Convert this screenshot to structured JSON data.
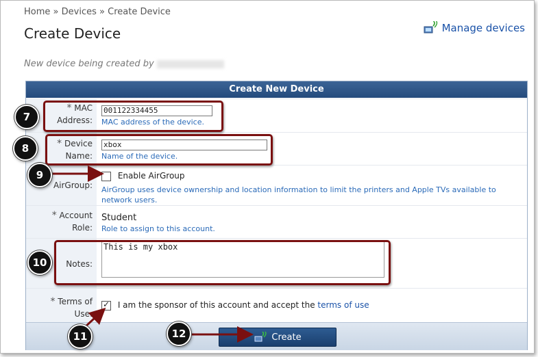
{
  "breadcrumb": {
    "home": "Home",
    "sep": "»",
    "devices": "Devices",
    "current": "Create Device"
  },
  "page_title": "Create Device",
  "manage_link": "Manage devices",
  "subtitle": "New device being created by",
  "form": {
    "header": "Create New Device",
    "required_mark": "*",
    "mac": {
      "label_1": "MAC",
      "label_2": "Address:",
      "value": "001122334455",
      "help": "MAC address of the device."
    },
    "device_name": {
      "label_1": "Device",
      "label_2": "Name:",
      "value": "xbox",
      "help": "Name of the device."
    },
    "airgroup": {
      "label": "AirGroup:",
      "checkbox_label": "Enable AirGroup",
      "checked": false,
      "help": "AirGroup uses device ownership and location information to limit the printers and Apple TVs available to network users."
    },
    "account_role": {
      "label_1": "Account",
      "label_2": "Role:",
      "value": "Student",
      "help": "Role to assign to this account."
    },
    "notes": {
      "label": "Notes:",
      "value": "This is my xbox"
    },
    "terms": {
      "label_1": "Terms of",
      "label_2": "Use:",
      "text": "I am the sponsor of this account and accept the",
      "link": "terms of use",
      "checked": true
    },
    "create_button": "Create"
  },
  "annotations": [
    "7",
    "8",
    "9",
    "10",
    "11",
    "12"
  ],
  "colors": {
    "header": "#234a7c",
    "link": "#1a52a8",
    "highlight": "#7a1010"
  },
  "icons": {
    "manage": "network-device-icon",
    "create": "network-device-icon"
  }
}
